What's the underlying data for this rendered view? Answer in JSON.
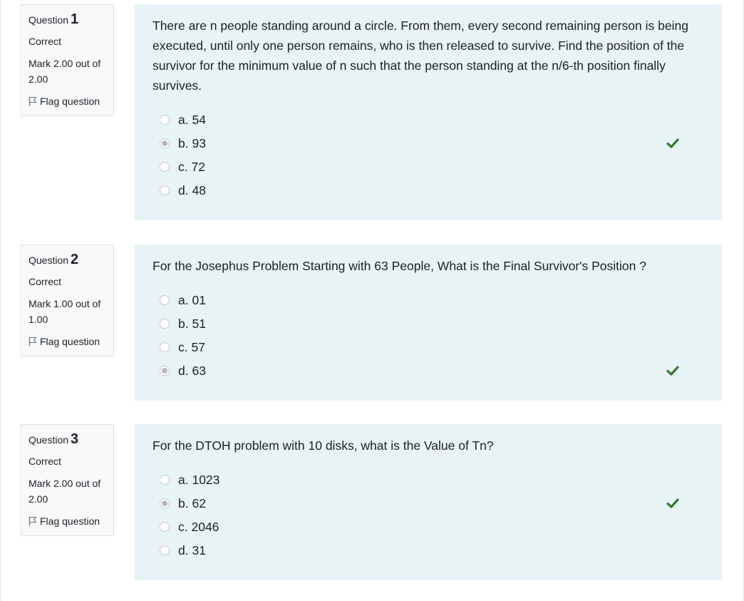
{
  "colors": {
    "panel_bg": "#e7f3f5",
    "info_bg": "#f8f9fa",
    "correct_green": "#357a32"
  },
  "questions": [
    {
      "label": "Question",
      "number": "1",
      "state": "Correct",
      "grade": "Mark 2.00 out of 2.00",
      "flag_label": "Flag question",
      "text": "There are n people standing around a circle. From them, every second remaining person is being executed, until only one person remains, who is then released to survive. Find the position of the survivor for the minimum value of n such that the person standing at the n/6-th position finally survives.",
      "answers": [
        {
          "label": "a. 54",
          "selected": false
        },
        {
          "label": "b. 93",
          "selected": true
        },
        {
          "label": "c. 72",
          "selected": false
        },
        {
          "label": "d. 48",
          "selected": false
        }
      ],
      "correct_icon": "check-icon"
    },
    {
      "label": "Question",
      "number": "2",
      "state": "Correct",
      "grade": "Mark 1.00 out of 1.00",
      "flag_label": "Flag question",
      "text": "For the Josephus Problem Starting with 63 People, What is the Final Survivor's Position ?",
      "answers": [
        {
          "label": "a. 01",
          "selected": false
        },
        {
          "label": "b. 51",
          "selected": false
        },
        {
          "label": "c. 57",
          "selected": false
        },
        {
          "label": "d. 63",
          "selected": true
        }
      ],
      "correct_icon": "check-icon"
    },
    {
      "label": "Question",
      "number": "3",
      "state": "Correct",
      "grade": "Mark 2.00 out of 2.00",
      "flag_label": "Flag question",
      "text": "For the DTOH problem with 10 disks, what is the Value of Tn?",
      "answers": [
        {
          "label": "a. 1023",
          "selected": false
        },
        {
          "label": "b. 62",
          "selected": true
        },
        {
          "label": "c. 2046",
          "selected": false
        },
        {
          "label": "d. 31",
          "selected": false
        }
      ],
      "correct_icon": "check-icon"
    }
  ]
}
